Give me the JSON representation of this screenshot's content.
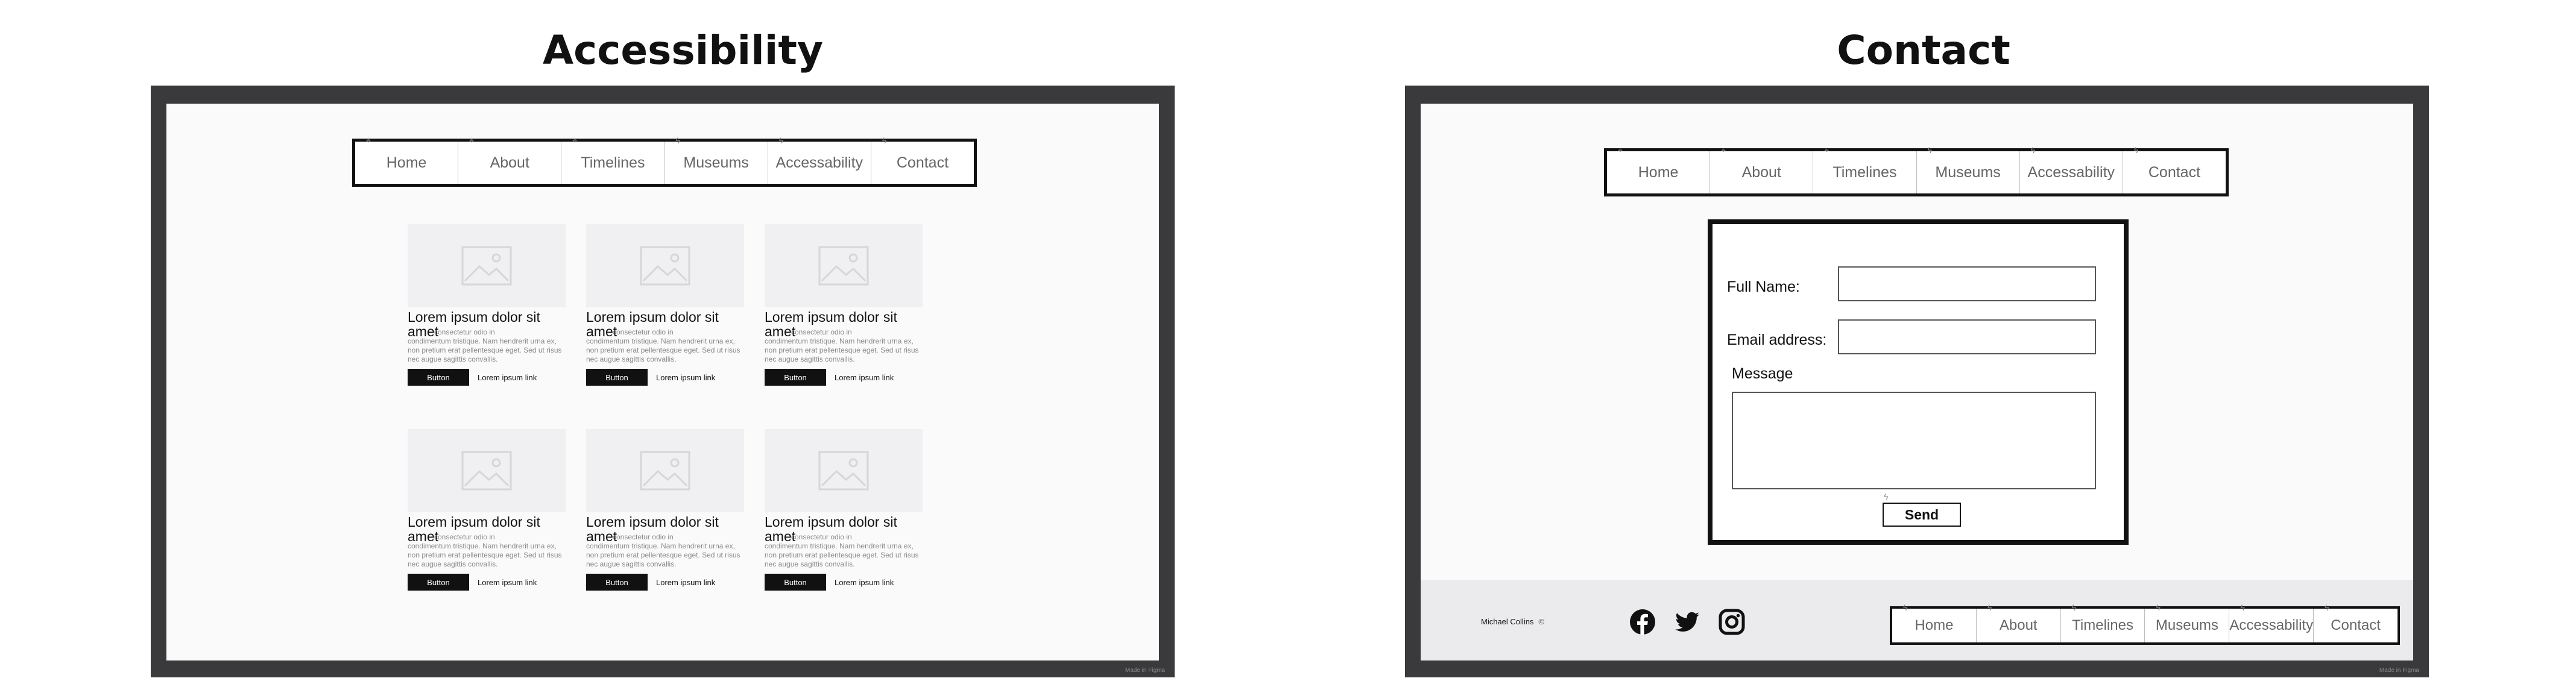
{
  "left": {
    "heading": "Accessibility",
    "nav": [
      "Home",
      "About",
      "Timelines",
      "Museums",
      "Accessability",
      "Contact"
    ],
    "cards": [
      {
        "title": "Lorem ipsum dolor sit amet",
        "text_a": "consectetur odio in",
        "text_b": "condimentum tristique. Nam hendrerit urna ex, non pretium erat pellentesque eget. Sed ut risus nec augue sagittis convallis.",
        "button": "Button",
        "link": "Lorem ipsum link"
      },
      {
        "title": "Lorem ipsum dolor sit amet",
        "text_a": "consectetur odio in",
        "text_b": "condimentum tristique. Nam hendrerit urna ex, non pretium erat pellentesque eget. Sed ut risus nec augue sagittis convallis.",
        "button": "Button",
        "link": "Lorem ipsum link"
      },
      {
        "title": "Lorem ipsum dolor sit amet",
        "text_a": "consectetur odio in",
        "text_b": "condimentum tristique. Nam hendrerit urna ex, non pretium erat pellentesque eget. Sed ut risus nec augue sagittis convallis.",
        "button": "Button",
        "link": "Lorem ipsum link"
      },
      {
        "title": "Lorem ipsum dolor sit amet",
        "text_a": "consectetur odio in",
        "text_b": "condimentum tristique. Nam hendrerit urna ex, non pretium erat pellentesque eget. Sed ut risus nec augue sagittis convallis.",
        "button": "Button",
        "link": "Lorem ipsum link"
      },
      {
        "title": "Lorem ipsum dolor sit amet",
        "text_a": "consectetur odio in",
        "text_b": "condimentum tristique. Nam hendrerit urna ex, non pretium erat pellentesque eget. Sed ut risus nec augue sagittis convallis.",
        "button": "Button",
        "link": "Lorem ipsum link"
      },
      {
        "title": "Lorem ipsum dolor sit amet",
        "text_a": "consectetur odio in",
        "text_b": "condimentum tristique. Nam hendrerit urna ex, non pretium erat pellentesque eget. Sed ut risus nec augue sagittis convallis.",
        "button": "Button",
        "link": "Lorem ipsum link"
      }
    ],
    "watermark": "Made in Figma"
  },
  "right": {
    "heading": "Contact",
    "nav": [
      "Home",
      "About",
      "Timelines",
      "Museums",
      "Accessability",
      "Contact"
    ],
    "form": {
      "full_name_label": "Full Name:",
      "email_label": "Email address:",
      "message_label": "Message",
      "send_label": "Send"
    },
    "footer": {
      "author": "Michael Collins",
      "copyright_symbol": "©",
      "social_icons": [
        "facebook-icon",
        "twitter-icon",
        "instagram-icon"
      ],
      "nav": [
        "Home",
        "About",
        "Timelines",
        "Museums",
        "Accessability",
        "Contact"
      ]
    },
    "watermark": "Made in Figma"
  },
  "colors": {
    "frame": "#3a3a3c",
    "screen": "#fafafa",
    "footer": "#ebebed",
    "nav_text": "#666666",
    "button_bg": "#111111"
  }
}
